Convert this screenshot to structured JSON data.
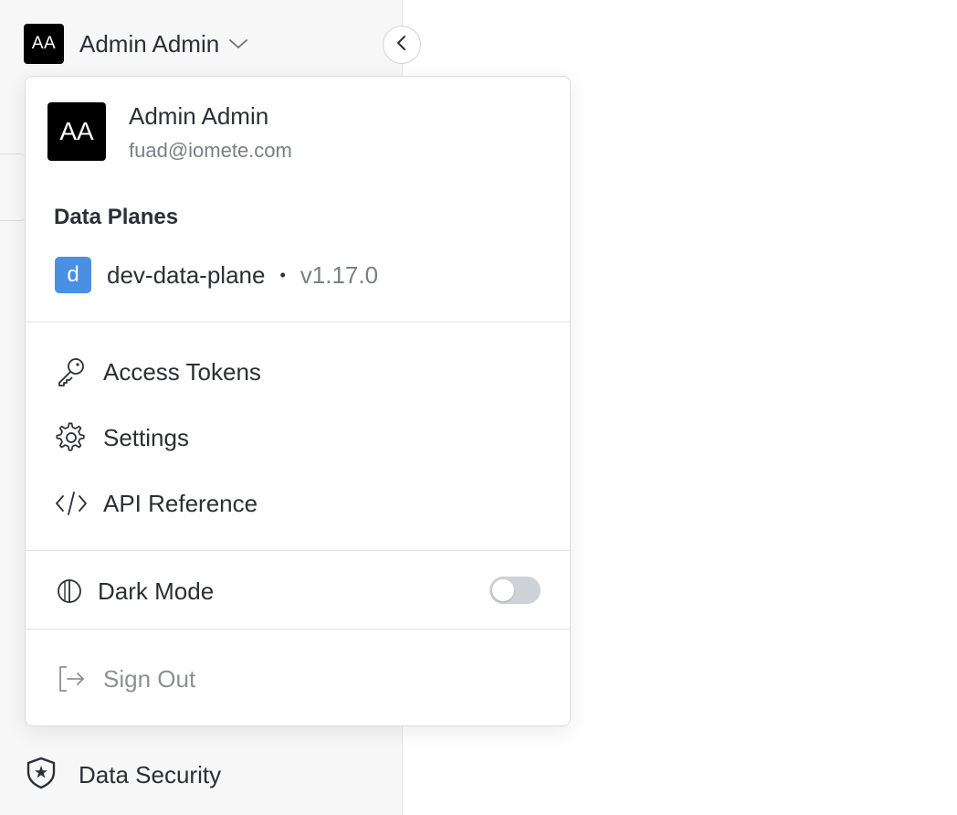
{
  "user": {
    "initials": "AA",
    "name": "Admin Admin",
    "email": "fuad@iomete.com"
  },
  "data_planes": {
    "title": "Data Planes",
    "items": [
      {
        "badge": "d",
        "name": "dev-data-plane",
        "separator": "•",
        "version": "v1.17.0",
        "badge_color": "#4a90e2"
      }
    ]
  },
  "menu": {
    "items": [
      {
        "label": "Access Tokens",
        "icon": "key-icon"
      },
      {
        "label": "Settings",
        "icon": "gear-icon"
      },
      {
        "label": "API Reference",
        "icon": "code-icon"
      }
    ],
    "dark_mode": {
      "label": "Dark Mode",
      "icon": "contrast-icon",
      "enabled": false
    },
    "sign_out": {
      "label": "Sign Out",
      "icon": "sign-out-icon"
    }
  },
  "sidebar": {
    "bottom_item": {
      "label": "Data Security",
      "icon": "shield-star-icon"
    }
  }
}
